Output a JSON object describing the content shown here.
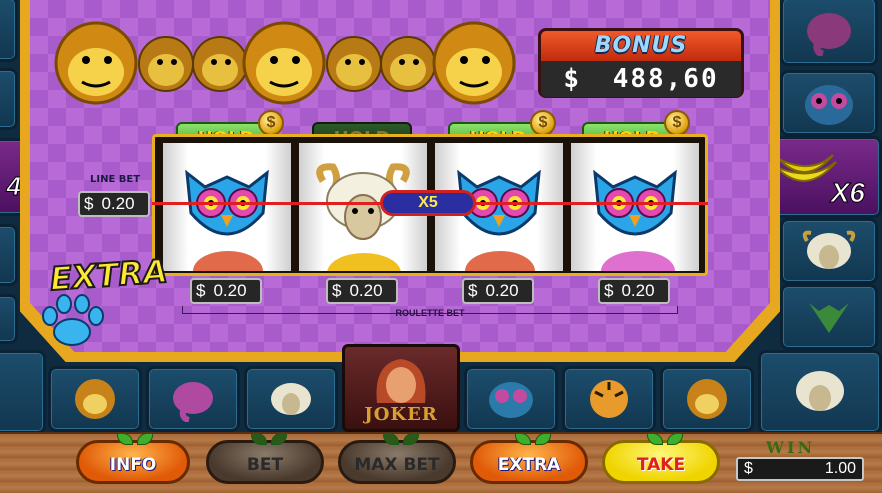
{
  "bonus": {
    "title": "BONUS",
    "currency": "$",
    "amount": "488,60"
  },
  "line_bet": {
    "label": "LINE BET",
    "currency": "$",
    "value": "0.20"
  },
  "reels": [
    {
      "hold_label": "HOLD",
      "hold_active": true,
      "coin": "$",
      "symbol": "owl-icon",
      "bet": "0.20"
    },
    {
      "hold_label": "HOLD",
      "hold_active": false,
      "coin": "",
      "symbol": "sheep-icon",
      "bet": "0.20"
    },
    {
      "hold_label": "HOLD",
      "hold_active": true,
      "coin": "$",
      "symbol": "owl-icon",
      "bet": "0.20"
    },
    {
      "hold_label": "HOLD",
      "hold_active": true,
      "coin": "$",
      "symbol": "owl-icon",
      "bet": "0.20"
    }
  ],
  "currency": "$",
  "payline_multiplier": "X5",
  "roulette_bet_label": "ROULETTE BET",
  "extra_logo": "EXTRA",
  "side_tiles": {
    "left_multiplier": "4",
    "right_multiplier": "X6"
  },
  "joker_label": "JOKER",
  "buttons": {
    "info": "INFO",
    "bet": "BET",
    "max_bet": "MAX BET",
    "extra": "EXTRA",
    "take": "TAKE"
  },
  "win": {
    "label": "WIN",
    "currency": "$",
    "amount": "1.00"
  },
  "colors": {
    "panel_purple": "#b86ad6",
    "frame_gold": "#e7a820",
    "payline_red": "#e02020",
    "button_orange": "#e05a08",
    "take_yellow": "#f0d400"
  }
}
